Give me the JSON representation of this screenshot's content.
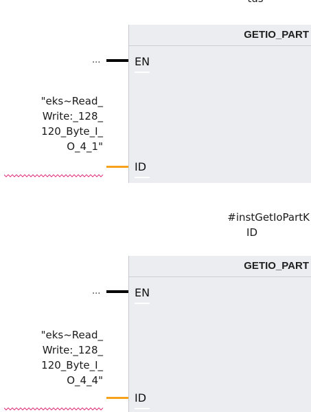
{
  "blocks": [
    {
      "instance_label": "tus",
      "title": "GETIO_PART",
      "en_connector": "...",
      "en_pin": "EN",
      "id_pin": "ID",
      "operand_lines": [
        "\"eks~Read_",
        "Write:_128_",
        "120_Byte_I_",
        "O_4_1\""
      ]
    },
    {
      "instance_label_lines": [
        "#instGetIoPartK",
        "ID"
      ],
      "title": "GETIO_PART",
      "en_connector": "...",
      "en_pin": "EN",
      "id_pin": "ID",
      "operand_lines": [
        "\"eks~Read_",
        "Write:_128_",
        "120_Byte_I_",
        "O_4_4\""
      ]
    }
  ],
  "colors": {
    "block_fill": "#ebedf0",
    "en_wire": "#000000",
    "id_wire": "#f7a21b",
    "error_underline": "#e0307a"
  }
}
